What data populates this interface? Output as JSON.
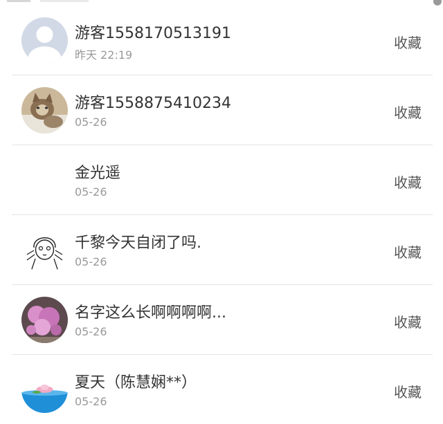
{
  "users": [
    {
      "name": "游客1558170513191",
      "time": "昨天 22:19",
      "action": "收藏",
      "avatar": "default-person-avatar"
    },
    {
      "name": "游客1558875410234",
      "time": "05-26",
      "action": "收藏",
      "avatar": "cat-photo-avatar"
    },
    {
      "name": "金光遥",
      "time": "05-26",
      "action": "收藏",
      "avatar": "blank-avatar"
    },
    {
      "name": "千黎今天自闭了吗.",
      "time": "05-26",
      "action": "收藏",
      "avatar": "sketch-girl-avatar"
    },
    {
      "name": "名字这么长啊啊啊啊...",
      "time": "05-26",
      "action": "收藏",
      "avatar": "flower-photo-avatar"
    },
    {
      "name": "夏天（陈慧娴**）",
      "time": "05-26",
      "action": "收藏",
      "avatar": "lotus-water-avatar"
    }
  ],
  "colors": {
    "name": "#333333",
    "time": "#999999",
    "action": "#555555",
    "divider": "#e3e3e3"
  }
}
